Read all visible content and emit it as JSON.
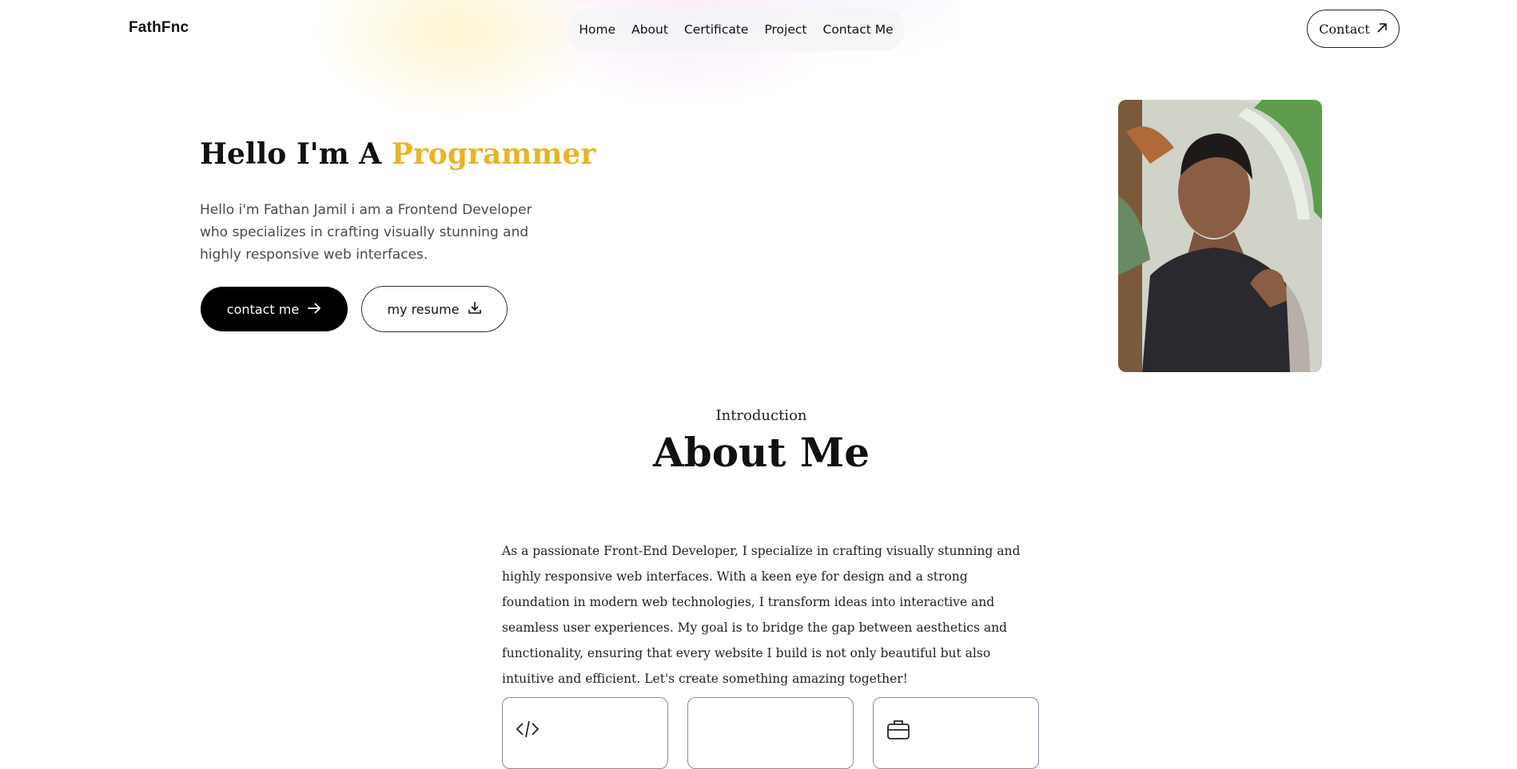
{
  "header": {
    "logo": "FathFnc",
    "nav": [
      "Home",
      "About",
      "Certificate",
      "Project",
      "Contact Me"
    ],
    "contact_button": "Contact",
    "contact_icon": "arrow-up-right-icon"
  },
  "hero": {
    "title_prefix": "Hello I'm A ",
    "title_highlight": "Programmer",
    "description": "Hello i'm Fathan Jamil i am a Frontend Developer who specializes in crafting visually stunning and highly responsive web interfaces.",
    "primary_button": "contact me",
    "primary_icon": "arrow-right-icon",
    "secondary_button": "my resume",
    "secondary_icon": "download-icon",
    "photo_alt": "profile-photo"
  },
  "about": {
    "label": "Introduction",
    "title": "About Me",
    "text": "As a passionate Front-End Developer, I specialize in crafting visually stunning and highly responsive web interfaces. With a keen eye for design and a strong foundation in modern web technologies, I transform ideas into interactive and seamless user experiences. My goal is to bridge the gap between aesthetics and functionality, ensuring that every website I build is not only beautiful but also intuitive and efficient. Let's create something amazing together!",
    "cards": [
      {
        "icon": "code-icon"
      },
      {
        "icon": ""
      },
      {
        "icon": "briefcase-icon"
      }
    ]
  },
  "colors": {
    "accent": "#e8b526",
    "primary_button_bg": "#000000"
  }
}
